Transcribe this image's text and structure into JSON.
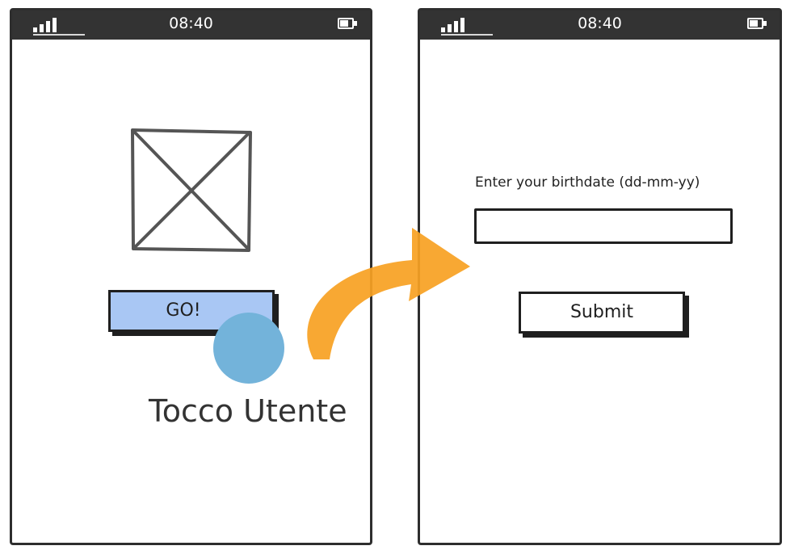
{
  "screens": {
    "left": {
      "status_time": "08:40",
      "go_label": "GO!"
    },
    "right": {
      "status_time": "08:40",
      "birthdate_label": "Enter your birthdate (dd-mm-yy)",
      "birthdate_value": "",
      "submit_label": "Submit"
    }
  },
  "annotation": {
    "touch_label": "Tocco Utente"
  },
  "colors": {
    "go_button": "#a9c7f4",
    "touch_dot": "#73b3da",
    "arrow": "#f7a123",
    "status_bar": "#333333"
  },
  "icons": [
    "signal-icon",
    "battery-icon",
    "image-placeholder-icon",
    "transition-arrow-icon"
  ]
}
